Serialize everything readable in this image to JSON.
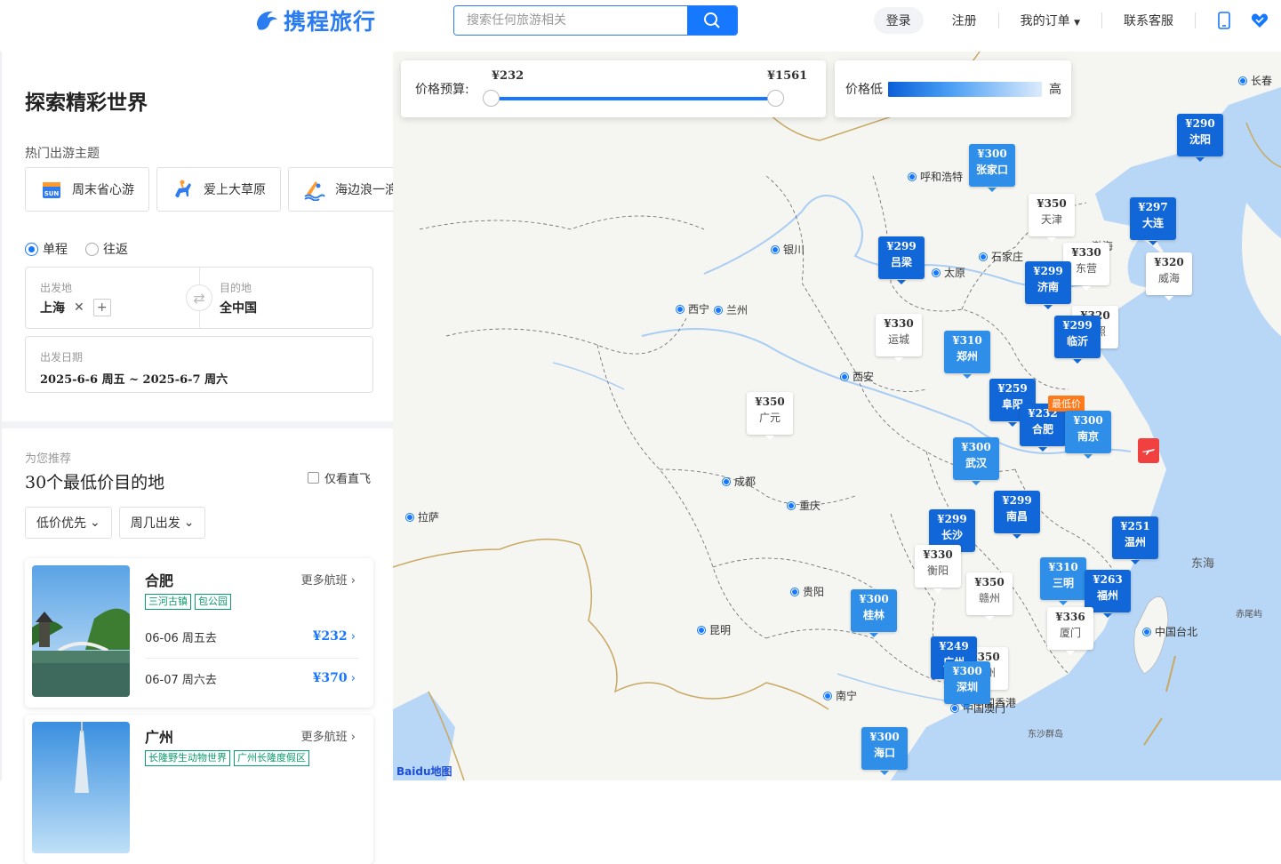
{
  "header": {
    "logo_text": "携程旅行",
    "search_placeholder": "搜索任何旅游相关",
    "login": "登录",
    "register": "注册",
    "my_orders": "我的订单",
    "contact": "联系客服"
  },
  "left": {
    "title": "探索精彩世界",
    "themes_title": "热门出游主题",
    "themes": [
      {
        "label": "周末省心游",
        "icon": "sun-calendar-icon"
      },
      {
        "label": "爱上大草原",
        "icon": "horse-rider-icon"
      },
      {
        "label": "海边浪一浪",
        "icon": "surf-icon"
      }
    ],
    "trip_one_way": "单程",
    "trip_round": "往返",
    "trip_selected": "单程",
    "from_label": "出发地",
    "from_value": "上海",
    "to_label": "目的地",
    "to_value": "全中国",
    "date_label": "出发日期",
    "date_value": "2025-6-6 周五 ~ 2025-6-7 周六",
    "rec_sub": "为您推荐",
    "rec_title": "30个最低价目的地",
    "direct_only": "仅看直飞",
    "filter_sort": "低价优先",
    "filter_weekday": "周几出发",
    "cards": [
      {
        "city": "合肥",
        "more": "更多航班",
        "tags": [
          "三河古镇",
          "包公园"
        ],
        "out_date": "06-06 周五去",
        "out_price": "¥232",
        "back_date": "06-07 周六去",
        "back_price": "¥370"
      },
      {
        "city": "广州",
        "more": "更多航班",
        "tags": [
          "长隆野生动物世界",
          "广州长隆度假区"
        ]
      }
    ]
  },
  "map": {
    "budget_label": "价格预算:",
    "budget_min": "¥232",
    "budget_max": "¥1561",
    "legend_low": "价格低",
    "legend_high": "高",
    "lowest_flag": "最低价",
    "pins": [
      {
        "price": "¥290",
        "city": "沈阳",
        "tone": "dark"
      },
      {
        "price": "¥300",
        "city": "张家口",
        "tone": "mid"
      },
      {
        "price": "¥350",
        "city": "天津",
        "tone": "light"
      },
      {
        "price": "¥297",
        "city": "大连",
        "tone": "dark"
      },
      {
        "price": "¥299",
        "city": "吕梁",
        "tone": "dark"
      },
      {
        "price": "¥330",
        "city": "东营",
        "tone": "light"
      },
      {
        "price": "¥299",
        "city": "济南",
        "tone": "dark"
      },
      {
        "price": "¥320",
        "city": "威海",
        "tone": "light"
      },
      {
        "price": "¥330",
        "city": "运城",
        "tone": "light"
      },
      {
        "price": "¥310",
        "city": "郑州",
        "tone": "mid"
      },
      {
        "price": "¥320",
        "city": "日照",
        "tone": "light"
      },
      {
        "price": "¥299",
        "city": "临沂",
        "tone": "dark"
      },
      {
        "price": "¥350",
        "city": "广元",
        "tone": "light"
      },
      {
        "price": "¥259",
        "city": "阜阳",
        "tone": "dark"
      },
      {
        "price": "¥232",
        "city": "合肥",
        "tone": "dark"
      },
      {
        "price": "¥300",
        "city": "南京",
        "tone": "mid"
      },
      {
        "price": "¥300",
        "city": "武汉",
        "tone": "mid"
      },
      {
        "price": "¥299",
        "city": "南昌",
        "tone": "dark"
      },
      {
        "price": "¥299",
        "city": "长沙",
        "tone": "dark"
      },
      {
        "price": "¥251",
        "city": "温州",
        "tone": "dark"
      },
      {
        "price": "¥330",
        "city": "衡阳",
        "tone": "light"
      },
      {
        "price": "¥350",
        "city": "赣州",
        "tone": "light"
      },
      {
        "price": "¥310",
        "city": "三明",
        "tone": "mid"
      },
      {
        "price": "¥263",
        "city": "福州",
        "tone": "dark"
      },
      {
        "price": "¥300",
        "city": "桂林",
        "tone": "mid"
      },
      {
        "price": "¥336",
        "city": "厦门",
        "tone": "light"
      },
      {
        "price": "¥350",
        "city": "惠州",
        "tone": "light"
      },
      {
        "price": "¥249",
        "city": "广州",
        "tone": "dark"
      },
      {
        "price": "¥300",
        "city": "深圳",
        "tone": "mid"
      },
      {
        "price": "¥300",
        "city": "海口",
        "tone": "mid"
      }
    ],
    "cities": [
      "长春",
      "呼和浩特",
      "银川",
      "石家庄",
      "太原",
      "西宁",
      "兰州",
      "西安",
      "成都",
      "重庆",
      "拉萨",
      "贵阳",
      "昆明",
      "南宁",
      "中国台北",
      "中国香港",
      "中国澳门"
    ],
    "seas": [
      "渤海",
      "东海",
      "东沙群岛",
      "赤尾屿"
    ],
    "brand": "Baidu地图"
  }
}
